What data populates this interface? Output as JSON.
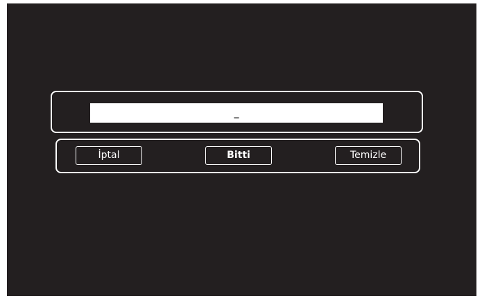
{
  "input": {
    "value": "_"
  },
  "buttons": {
    "cancel": "İptal",
    "done": "Bitti",
    "clear": "Temizle"
  },
  "colors": {
    "background": "#231f20",
    "frame": "#ffffff",
    "field": "#ffffff"
  }
}
